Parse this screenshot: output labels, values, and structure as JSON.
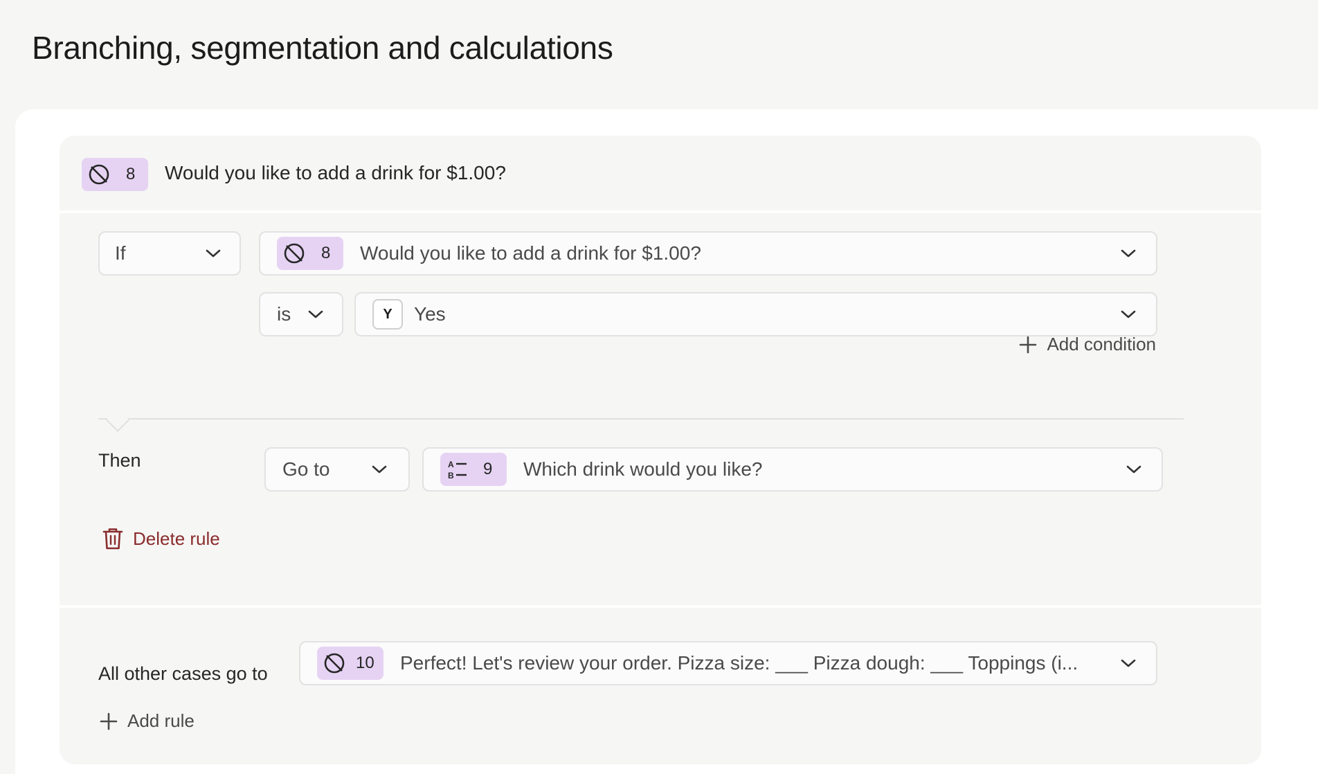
{
  "page": {
    "title": "Branching, segmentation and calculations"
  },
  "question": {
    "number": "8",
    "text": "Would you like to add a drink for $1.00?"
  },
  "rule": {
    "condition_type": "If",
    "field": {
      "number": "8",
      "text": "Would you like to add a drink for $1.00?"
    },
    "operator": "is",
    "value": {
      "key": "Y",
      "label": "Yes"
    },
    "add_condition_label": "Add condition",
    "then_label": "Then",
    "action": "Go to",
    "target": {
      "number": "9",
      "text": "Which drink would you like?"
    },
    "delete_label": "Delete rule"
  },
  "other_cases": {
    "label": "All other cases go to",
    "target": {
      "number": "10",
      "text": "Perfect! Let's review your order. Pizza size: ___ Pizza dough: ___ Toppings (i..."
    }
  },
  "add_rule_label": "Add rule",
  "icons": {
    "question_type": "no-symbol-icon",
    "target_type": "multiple-choice-icon",
    "chevron": "chevron-down-icon",
    "add": "plus-icon",
    "delete": "trash-icon"
  },
  "colors": {
    "badge": "#e6d3f3",
    "delete": "#8a2c2c",
    "background": "#f6f6f5"
  }
}
